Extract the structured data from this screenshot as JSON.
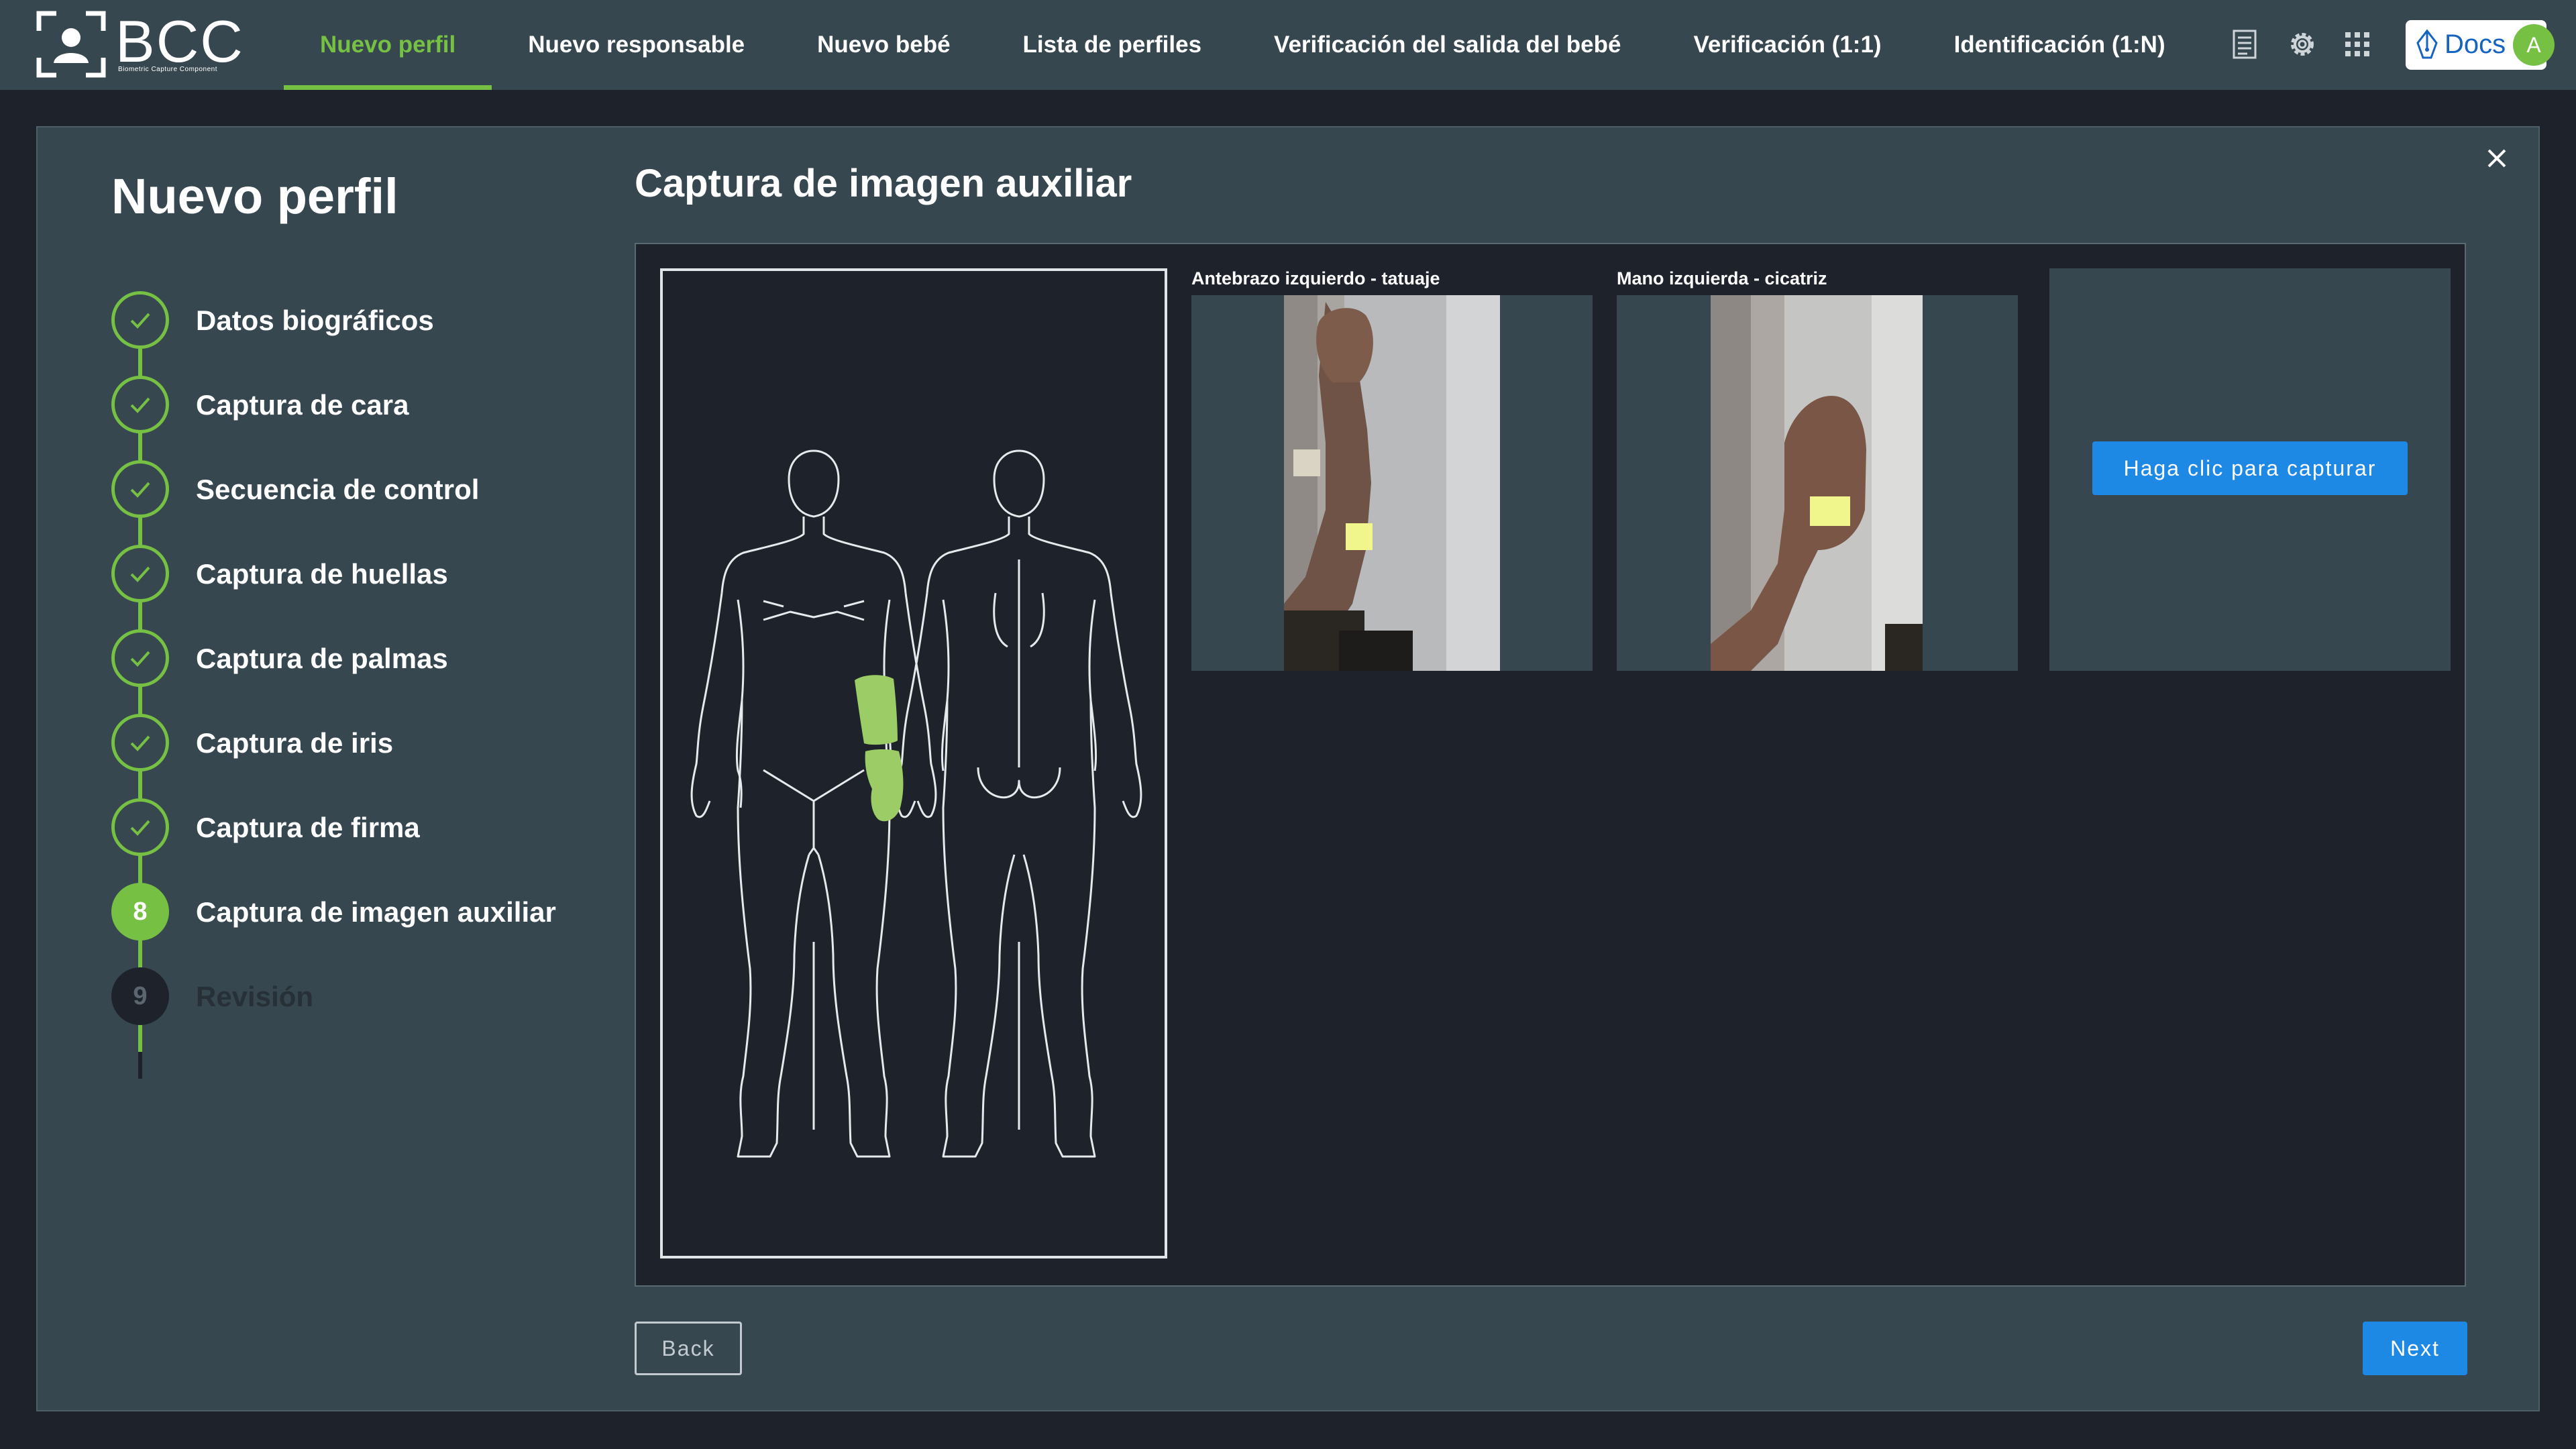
{
  "brand": {
    "name": "BCC",
    "subtitle": "Biometric Capture Component"
  },
  "nav": {
    "items": [
      {
        "label": "Nuevo perfil",
        "active": true
      },
      {
        "label": "Nuevo responsable",
        "active": false
      },
      {
        "label": "Nuevo bebé",
        "active": false
      },
      {
        "label": "Lista de perfiles",
        "active": false
      },
      {
        "label": "Verificación del salida del bebé",
        "active": false
      },
      {
        "label": "Verificación (1:1)",
        "active": false
      },
      {
        "label": "Identificación (1:N)",
        "active": false
      }
    ]
  },
  "toolbar": {
    "icons": [
      "document-icon",
      "gear-icon",
      "apps-grid-icon"
    ],
    "docs_label": "Docs",
    "avatar_initial": "A"
  },
  "page": {
    "title": "Nuevo perfil",
    "section_title": "Captura de imagen auxiliar"
  },
  "stepper": {
    "steps": [
      {
        "number": "1",
        "label": "Datos biográficos",
        "state": "done"
      },
      {
        "number": "2",
        "label": "Captura de cara",
        "state": "done"
      },
      {
        "number": "3",
        "label": "Secuencia de control",
        "state": "done"
      },
      {
        "number": "4",
        "label": "Captura de huellas",
        "state": "done"
      },
      {
        "number": "5",
        "label": "Captura de palmas",
        "state": "done"
      },
      {
        "number": "6",
        "label": "Captura de iris",
        "state": "done"
      },
      {
        "number": "7",
        "label": "Captura de firma",
        "state": "done"
      },
      {
        "number": "8",
        "label": "Captura de imagen auxiliar",
        "state": "current"
      },
      {
        "number": "9",
        "label": "Revisión",
        "state": "pending"
      }
    ]
  },
  "captures": [
    {
      "label": "Antebrazo izquierdo - tatuaje"
    },
    {
      "label": "Mano izquierda - cicatriz"
    }
  ],
  "capture_button": "Haga clic para capturar",
  "actions": {
    "back": "Back",
    "next": "Next"
  },
  "colors": {
    "accent": "#76c043",
    "primary_button": "#1e88e5",
    "panel": "#37474f",
    "background": "#1e222a",
    "highlight_region": "#9ccc65"
  }
}
